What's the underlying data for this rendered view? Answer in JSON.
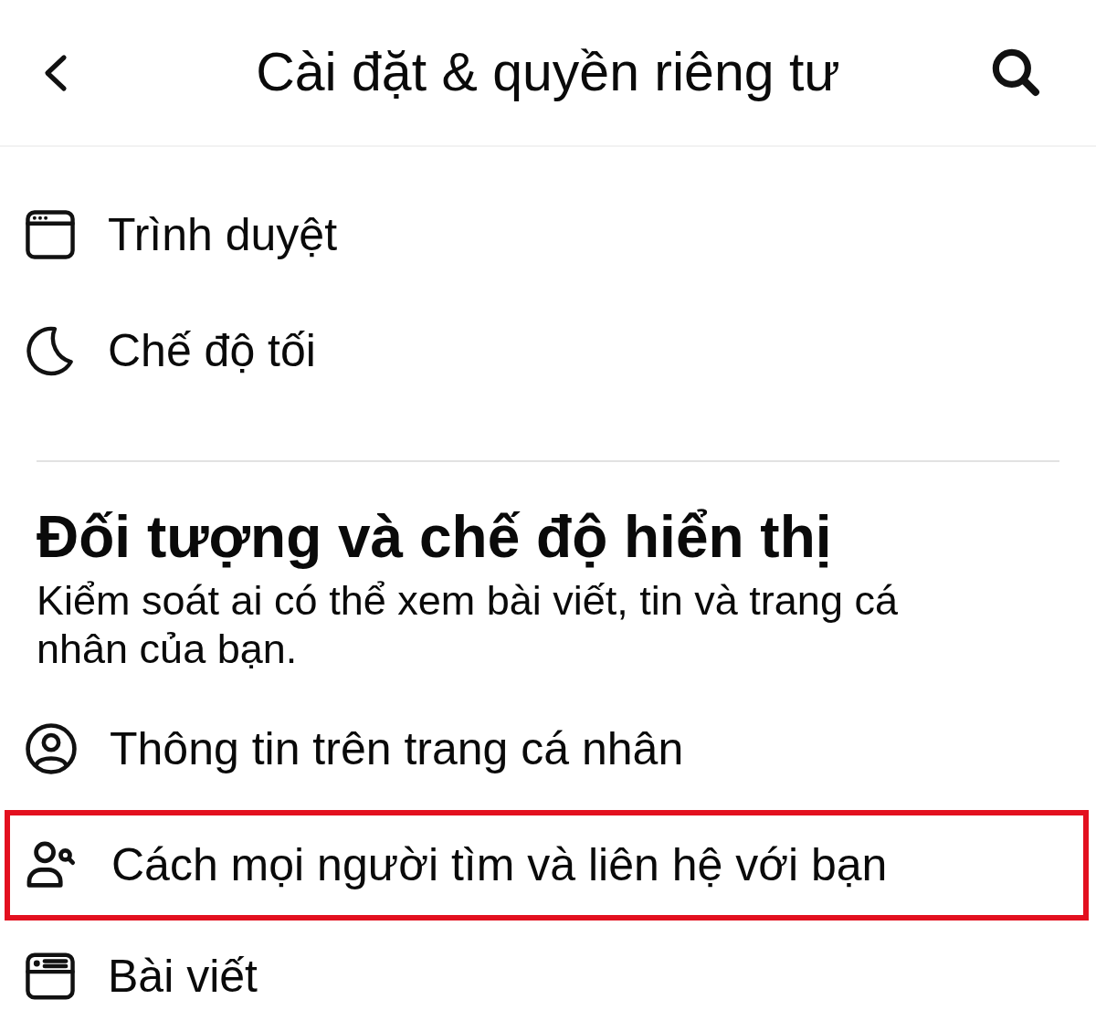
{
  "header": {
    "title": "Cài đặt & quyền riêng tư"
  },
  "sections": [
    {
      "items": [
        {
          "label": "Trình duyệt",
          "highlighted": false
        },
        {
          "label": "Chế độ tối",
          "highlighted": false
        }
      ]
    },
    {
      "title": "Đối tượng và chế độ hiển thị",
      "description": "Kiểm soát ai có thể xem bài viết, tin và trang cá nhân của bạn.",
      "items": [
        {
          "label": "Thông tin trên trang cá nhân",
          "highlighted": false
        },
        {
          "label": "Cách mọi người tìm và liên hệ với bạn",
          "highlighted": true
        },
        {
          "label": "Bài viết",
          "highlighted": false
        }
      ]
    }
  ]
}
